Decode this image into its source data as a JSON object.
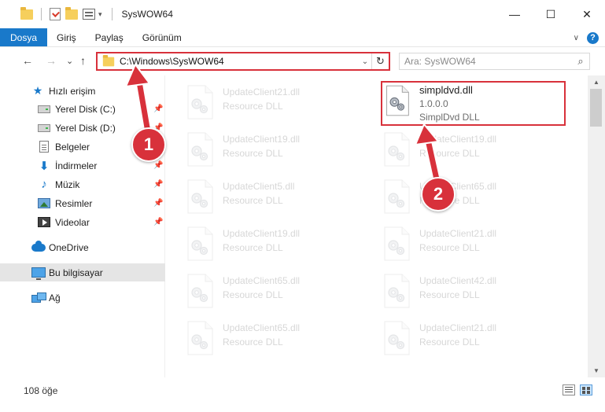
{
  "window": {
    "title": "SysWOW64",
    "minimize_glyph": "—",
    "maximize_glyph": "☐",
    "close_glyph": "✕"
  },
  "ribbon": {
    "tabs": [
      {
        "label": "Dosya"
      },
      {
        "label": "Giriş"
      },
      {
        "label": "Paylaş"
      },
      {
        "label": "Görünüm"
      }
    ],
    "help_label": "?"
  },
  "nav": {
    "back_glyph": "←",
    "forward_glyph": "→",
    "recent_glyph": "⌄",
    "up_glyph": "↑"
  },
  "address": {
    "path": "C:\\Windows\\SysWOW64",
    "refresh_glyph": "↻"
  },
  "search": {
    "placeholder": "Ara: SysWOW64"
  },
  "sidebar": {
    "items": [
      {
        "label": "Hızlı erişim",
        "icon": "star-icon"
      },
      {
        "label": "Yerel Disk (C:)",
        "icon": "disk-icon",
        "pinned": true
      },
      {
        "label": "Yerel Disk (D:)",
        "icon": "disk-icon",
        "pinned": true
      },
      {
        "label": "Belgeler",
        "icon": "document-icon",
        "pinned": true
      },
      {
        "label": "İndirmeler",
        "icon": "download-icon",
        "pinned": true
      },
      {
        "label": "Müzik",
        "icon": "music-icon",
        "pinned": true
      },
      {
        "label": "Resimler",
        "icon": "pictures-icon",
        "pinned": true
      },
      {
        "label": "Videolar",
        "icon": "videos-icon",
        "pinned": true
      },
      {
        "label": "OneDrive",
        "icon": "onedrive-icon"
      },
      {
        "label": "Bu bilgisayar",
        "icon": "this-pc-icon",
        "selected": true
      },
      {
        "label": "Ağ",
        "icon": "network-icon"
      }
    ]
  },
  "files": {
    "left_column": [
      {
        "name": "UpdateClient21.dll",
        "type": "Resource DLL"
      },
      {
        "name": "UpdateClient19.dll",
        "type": "Resource DLL"
      },
      {
        "name": "UpdateClient5.dll",
        "type": "Resource DLL"
      },
      {
        "name": "UpdateClient19.dll",
        "type": "Resource DLL"
      },
      {
        "name": "UpdateClient65.dll",
        "type": "Resource DLL"
      },
      {
        "name": "UpdateClient65.dll",
        "type": "Resource DLL"
      }
    ],
    "right_column": [
      {
        "name": "UpdateClient19.dll",
        "type": "Resource DLL"
      },
      {
        "name": "UpdateClient65.dll",
        "type": "Resource DLL"
      },
      {
        "name": "UpdateClient21.dll",
        "type": "Resource DLL"
      },
      {
        "name": "UpdateClient42.dll",
        "type": "Resource DLL"
      },
      {
        "name": "UpdateClient21.dll",
        "type": "Resource DLL"
      }
    ],
    "highlighted": {
      "name": "simpldvd.dll",
      "version": "1.0.0.0",
      "description": "SimplDvd DLL"
    }
  },
  "status": {
    "item_count": "108 öğe"
  },
  "annotations": {
    "step1": "1",
    "step2": "2",
    "color": "#d8313b"
  }
}
